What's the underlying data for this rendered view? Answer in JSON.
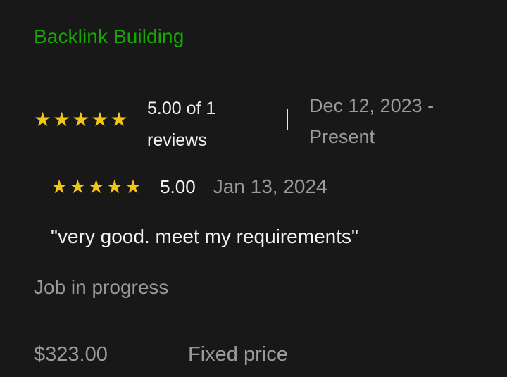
{
  "job": {
    "title": "Backlink Building",
    "rating_summary": {
      "star_count": 5,
      "score_text": "5.00 of 1 reviews"
    },
    "date_range": "Dec 12, 2023 - Present",
    "review": {
      "star_count": 5,
      "score": "5.00",
      "date": "Jan 13, 2024",
      "comment": "\"very good. meet my requirements\""
    },
    "status": "Job in progress",
    "price": "$323.00",
    "price_type": "Fixed price"
  },
  "colors": {
    "background": "#181818",
    "title_green": "#14a800",
    "star_gold": "#f0c419",
    "muted_text": "#9a9a9a",
    "primary_text": "#f2f2f2"
  },
  "icons": {
    "star": "star-icon"
  }
}
